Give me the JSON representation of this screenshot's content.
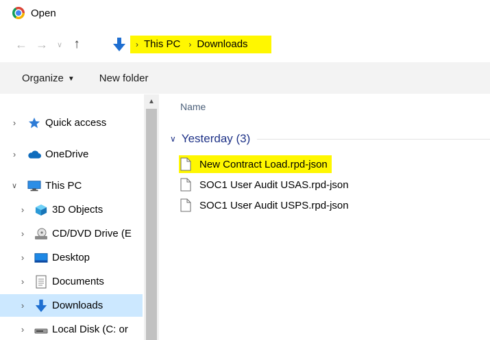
{
  "window": {
    "title": "Open"
  },
  "navigation": {
    "back_glyph": "←",
    "forward_glyph": "→",
    "recent_glyph": "∨",
    "up_glyph": "↑"
  },
  "address_bar": {
    "icon": "downloads-arrow-icon",
    "path": [
      "This PC",
      "Downloads"
    ],
    "highlight_color": "#fff700"
  },
  "toolbar": {
    "organize_label": "Organize",
    "new_folder_label": "New folder"
  },
  "sidebar": {
    "items": [
      {
        "label": "Quick access",
        "icon": "star-icon",
        "expander": "›"
      },
      {
        "label": "OneDrive",
        "icon": "cloud-icon",
        "expander": "›"
      },
      {
        "label": "This PC",
        "icon": "monitor-icon",
        "expander": "∨"
      },
      {
        "label": "3D Objects",
        "icon": "cube-icon",
        "expander": "›"
      },
      {
        "label": "CD/DVD Drive (E",
        "icon": "disc-drive-icon",
        "expander": "›"
      },
      {
        "label": "Desktop",
        "icon": "desktop-icon",
        "expander": "›"
      },
      {
        "label": "Documents",
        "icon": "document-icon",
        "expander": "›"
      },
      {
        "label": "Downloads",
        "icon": "downloads-arrow-icon",
        "expander": "›",
        "selected": true
      },
      {
        "label": "Local Disk (C: or",
        "icon": "hard-disk-icon",
        "expander": "›"
      }
    ],
    "selected_color": "#cce8ff"
  },
  "content": {
    "column_header": "Name",
    "group": {
      "label": "Yesterday (3)"
    },
    "files": [
      {
        "name": "New Contract Load.rpd-json",
        "highlighted": true
      },
      {
        "name": "SOC1 User Audit USAS.rpd-json"
      },
      {
        "name": "SOC1 User Audit USPS.rpd-json"
      }
    ]
  }
}
